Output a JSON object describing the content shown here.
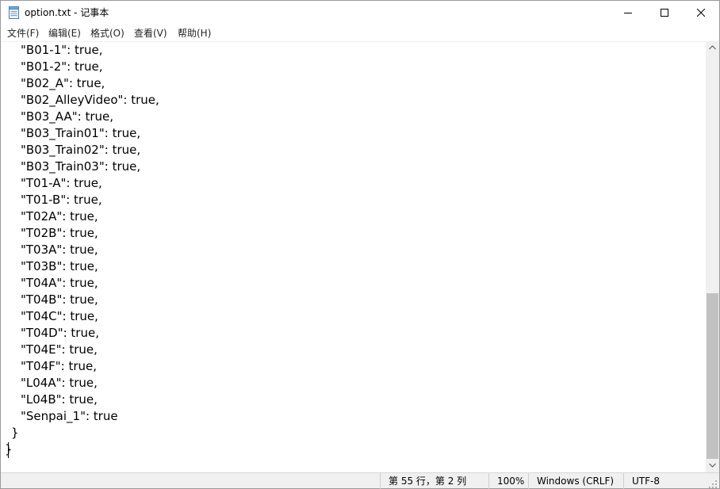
{
  "window": {
    "title": "option.txt - 记事本",
    "app_icon": "notepad-icon",
    "controls": {
      "minimize": "minimize-icon",
      "maximize": "maximize-icon",
      "close": "close-icon"
    }
  },
  "menu": [
    {
      "id": "file",
      "label": "文件(F)"
    },
    {
      "id": "edit",
      "label": "编辑(E)"
    },
    {
      "id": "format",
      "label": "格式(O)"
    },
    {
      "id": "view",
      "label": "查看(V)"
    },
    {
      "id": "help",
      "label": "帮助(H)"
    }
  ],
  "editor": {
    "lines": [
      "\"B01-1\": true,",
      "\"B01-2\": true,",
      "\"B02_A\": true,",
      "\"B02_AlleyVideo\": true,",
      "\"B03_AA\": true,",
      "\"B03_Train01\": true,",
      "\"B03_Train02\": true,",
      "\"B03_Train03\": true,",
      "\"T01-A\": true,",
      "\"T01-B\": true,",
      "\"T02A\": true,",
      "\"T02B\": true,",
      "\"T03A\": true,",
      "\"T03B\": true,",
      "\"T04A\": true,",
      "\"T04B\": true,",
      "\"T04C\": true,",
      "\"T04D\": true,",
      "\"T04E\": true,",
      "\"T04F\": true,",
      "\"L04A\": true,",
      "\"L04B\": true,",
      "\"Senpai_1\": true"
    ],
    "closing_lines": [
      "}",
      "}"
    ]
  },
  "scrollbar": {
    "position": 0.59,
    "visible_fraction": 0.41
  },
  "status": {
    "position": "第 55 行，第 2 列",
    "zoom": "100%",
    "line_endings": "Windows (CRLF)",
    "encoding": "UTF-8"
  }
}
